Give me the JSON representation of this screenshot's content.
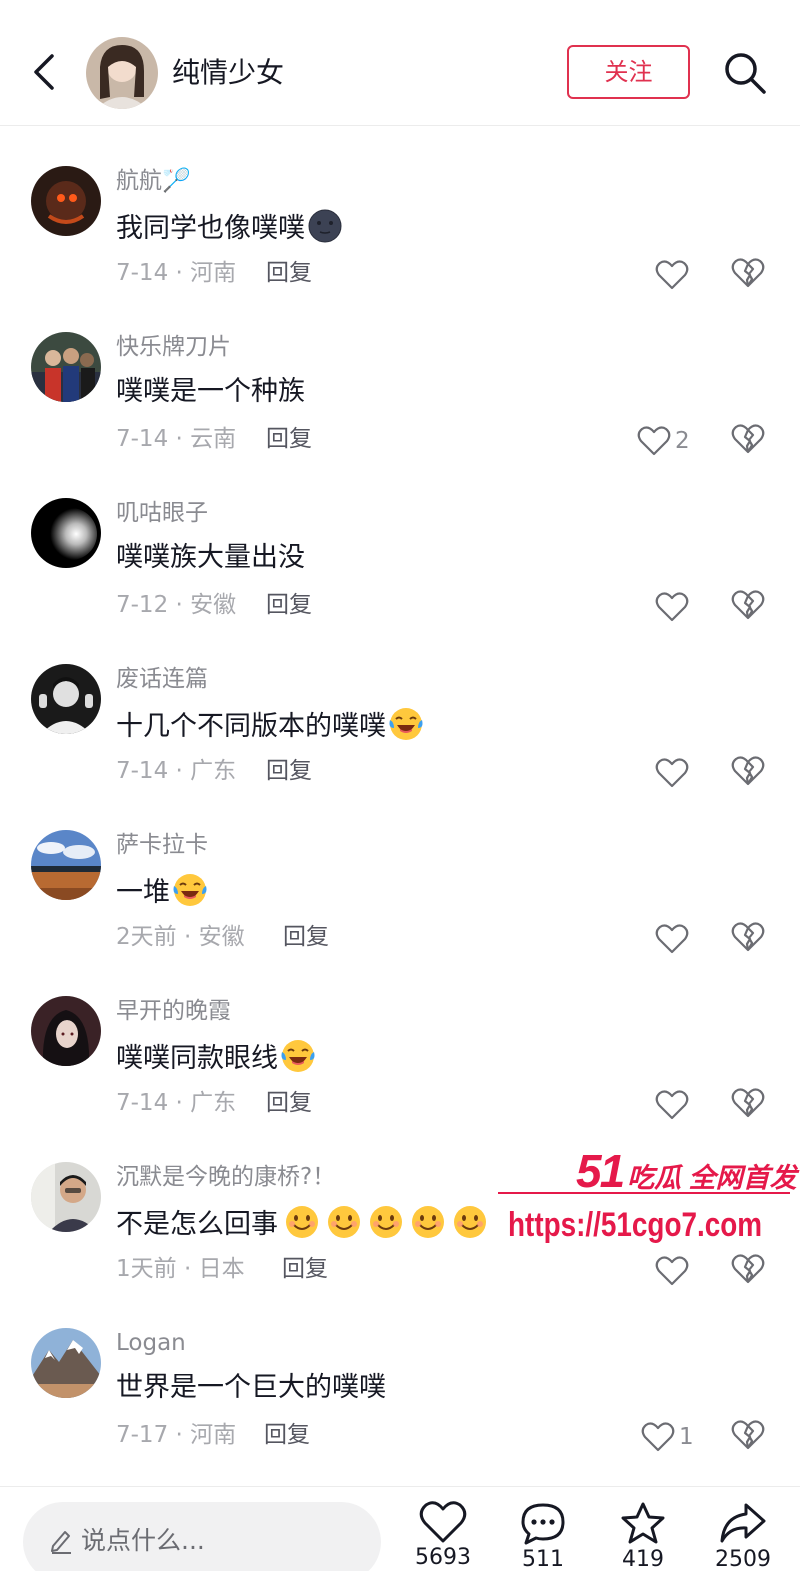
{
  "header": {
    "title": "纯情少女",
    "follow_label": "关注"
  },
  "comments": [
    {
      "name": "航航🏸",
      "text": "我同学也像噗噗",
      "emoji": "new-moon-face",
      "date": "7-14",
      "location": "河南",
      "reply": "回复",
      "likes": ""
    },
    {
      "name": "快乐牌刀片",
      "text": "噗噗是一个种族",
      "emoji": "",
      "date": "7-14",
      "location": "云南",
      "reply": "回复",
      "likes": "2"
    },
    {
      "name": "叽咕眼子",
      "text": "噗噗族大量出没",
      "emoji": "",
      "date": "7-12",
      "location": "安徽",
      "reply": "回复",
      "likes": ""
    },
    {
      "name": "废话连篇",
      "text": "十几个不同版本的噗噗",
      "emoji": "crying-laughing",
      "date": "7-14",
      "location": "广东",
      "reply": "回复",
      "likes": ""
    },
    {
      "name": "萨卡拉卡",
      "text": "一堆",
      "emoji": "crying-laughing",
      "date": "2天前",
      "location": "安徽",
      "reply": "回复",
      "likes": ""
    },
    {
      "name": "早开的晚霞",
      "text": "噗噗同款眼线",
      "emoji": "crying-laughing",
      "date": "7-14",
      "location": "广东",
      "reply": "回复",
      "likes": ""
    },
    {
      "name": "沉默是今晚的康桥?！",
      "text": "不是怎么回事",
      "emoji": "smile-x5",
      "date": "1天前",
      "location": "日本",
      "reply": "回复",
      "likes": ""
    },
    {
      "name": "Logan",
      "text": "世界是一个巨大的噗噗",
      "emoji": "",
      "date": "7-17",
      "location": "河南",
      "reply": "回复",
      "likes": "1"
    }
  ],
  "watermark": {
    "brand_num": "51",
    "brand_text": "吃瓜 全网首发",
    "url": "https://51cgo7.com"
  },
  "bottom_bar": {
    "input_placeholder": "说点什么...",
    "like_count": "5693",
    "comment_count": "511",
    "favorite_count": "419",
    "share_count": "2509"
  },
  "colors": {
    "accent": "#e0314f",
    "watermark": "#e5194a",
    "text_primary": "#161823",
    "text_secondary": "#8a8b91"
  }
}
